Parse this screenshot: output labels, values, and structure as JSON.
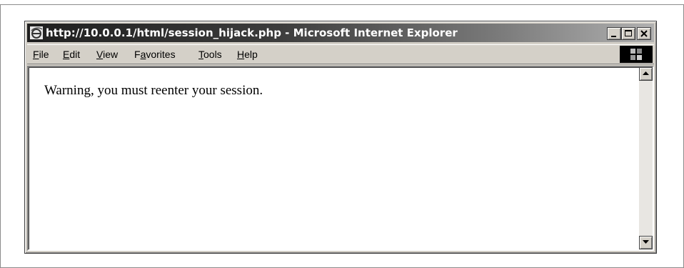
{
  "window": {
    "title": "http://10.0.0.1/html/session_hijack.php - Microsoft Internet Explorer",
    "app_icon": "ie-icon",
    "controls": [
      "minimize-icon",
      "maximize-icon",
      "close-icon"
    ]
  },
  "menubar": {
    "items": [
      {
        "accel": "F",
        "rest": "ile"
      },
      {
        "accel": "E",
        "rest": "dit"
      },
      {
        "accel": "V",
        "rest": "iew"
      },
      {
        "pre": "F",
        "accel": "a",
        "rest": "vorites"
      },
      {
        "accel": "T",
        "rest": "ools"
      },
      {
        "accel": "H",
        "rest": "elp"
      }
    ],
    "throbber_icon": "windows-logo-icon"
  },
  "content": {
    "message": "Warning, you must reenter your session."
  },
  "scrollbar": {
    "up_icon": "scroll-up-arrow-icon",
    "down_icon": "scroll-down-arrow-icon"
  }
}
